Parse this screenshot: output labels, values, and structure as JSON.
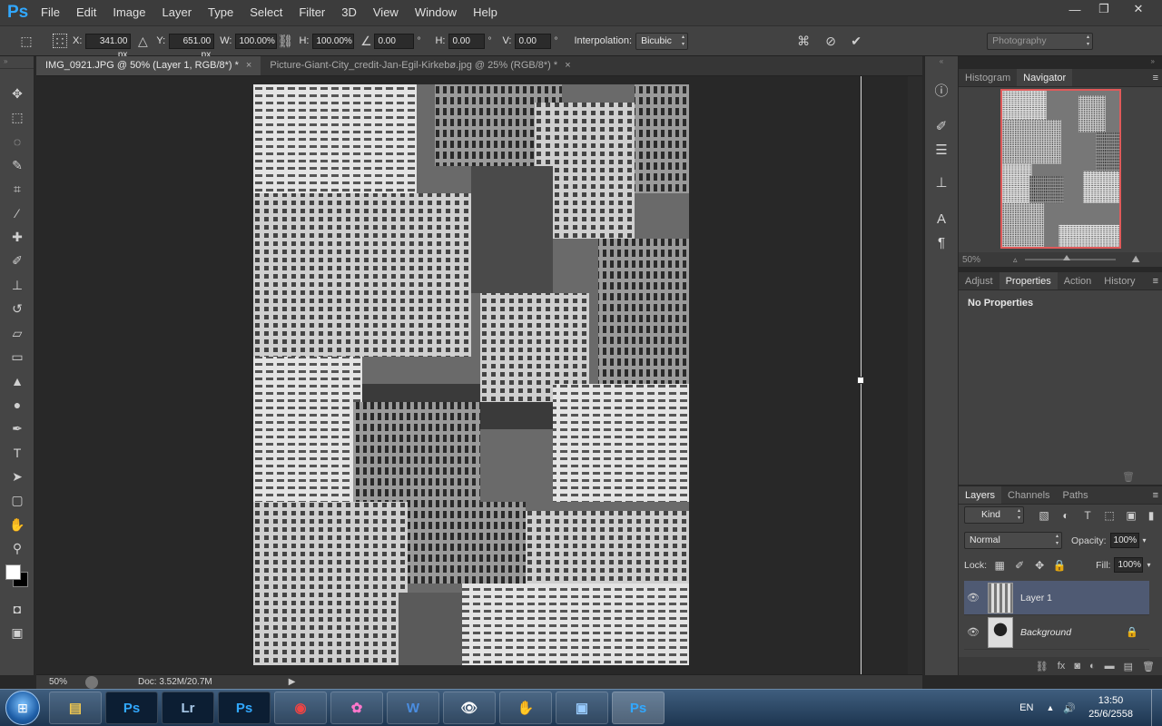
{
  "app": {
    "logo": "Ps"
  },
  "menu": [
    "File",
    "Edit",
    "Image",
    "Layer",
    "Type",
    "Select",
    "Filter",
    "3D",
    "View",
    "Window",
    "Help"
  ],
  "window_controls": {
    "minimize": "—",
    "restore": "❐",
    "close": "✕"
  },
  "options": {
    "x_label": "X:",
    "x_value": "341.00 px",
    "y_label": "Y:",
    "y_value": "651.00 px",
    "w_label": "W:",
    "w_value": "100.00%",
    "h_label": "H:",
    "h_value": "100.00%",
    "angle_value": "0.00",
    "angle_unit": "°",
    "hskew_label": "H:",
    "hskew_value": "0.00",
    "hskew_unit": "°",
    "vskew_label": "V:",
    "vskew_value": "0.00",
    "vskew_unit": "°",
    "interp_label": "Interpolation:",
    "interp_value": "Bicubic",
    "workspace": "Photography"
  },
  "tabs": [
    {
      "label": "IMG_0921.JPG @ 50% (Layer 1, RGB/8*) *",
      "close": "×"
    },
    {
      "label": "Picture-Giant-City_credit-Jan-Egil-Kirkebø.jpg @ 25% (RGB/8*) *",
      "close": "×"
    }
  ],
  "status": {
    "zoom": "50%",
    "doc": "Doc: 3.52M/20.7M"
  },
  "navigator": {
    "tabs": [
      "Histogram",
      "Navigator"
    ],
    "zoom": "50%"
  },
  "properties": {
    "tabs": [
      "Adjust",
      "Properties",
      "Action",
      "History"
    ],
    "message": "No Properties"
  },
  "layers_panel": {
    "tabs": [
      "Layers",
      "Channels",
      "Paths"
    ],
    "kind": "Kind",
    "blend_mode": "Normal",
    "opacity_label": "Opacity:",
    "opacity_value": "100%",
    "lock_label": "Lock:",
    "fill_label": "Fill:",
    "fill_value": "100%",
    "layers": [
      {
        "name": "Layer 1",
        "selected": true
      },
      {
        "name": "Background",
        "locked": true
      }
    ]
  },
  "taskbar": {
    "apps": [
      "Explorer",
      "Ps",
      "Lr",
      "Ps",
      "Chrome",
      "Paint",
      "W",
      "Viewer",
      "Hand",
      "Photos",
      "Ps"
    ],
    "language": "EN",
    "time": "13:50",
    "date": "25/6/2558"
  },
  "colors": {
    "accent": "#31a8ff",
    "selection": "#4f5a73",
    "navigator_frame": "#e05a5a"
  }
}
